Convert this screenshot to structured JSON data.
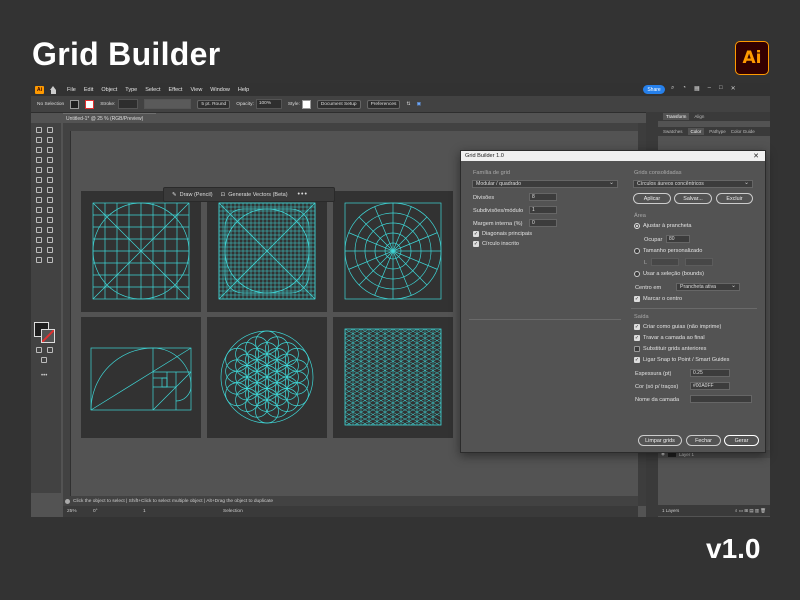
{
  "promo": {
    "title": "Grid Builder",
    "app_logo": "Ai",
    "version": "v1.0"
  },
  "menubar": {
    "app_badge": "Ai",
    "items": [
      "File",
      "Edit",
      "Object",
      "Type",
      "Select",
      "Effect",
      "View",
      "Window",
      "Help"
    ],
    "share": "Share"
  },
  "control_bar": {
    "selection": "No Selection",
    "stroke_label": "Stroke:",
    "brush": "5 pt. Round",
    "opacity_label": "Opacity:",
    "opacity_value": "100%",
    "style_label": "Style:",
    "document_setup": "Document Setup",
    "preferences": "Preferences"
  },
  "document_tab": {
    "title": "Untitled-1* @ 25 % (RGB/Preview)"
  },
  "floating_bar": {
    "draw": "Draw (Pencil)",
    "generate": "Generate Vectors (Beta)",
    "more": "•••"
  },
  "status": {
    "hint": "Click the object to select  |  Shift+Click to select multiple object  |  Alt+Drag the object to duplicate",
    "zoom": "25%",
    "angle": "0°",
    "page": "1",
    "mode": "Selection"
  },
  "panels": {
    "tabs_top": [
      "Transform",
      "Align"
    ],
    "tabs_second": [
      "Swatches",
      "Color",
      "Pathype",
      "Color Guide"
    ],
    "layer_name": "Layer 1",
    "layers_count": "1 Layers"
  },
  "dialog": {
    "title": "Grid Builder 1.0",
    "left": {
      "family_label": "Família de grid",
      "family_value": "Modular / quadrado",
      "fields": [
        {
          "label": "Divisões",
          "value": "8"
        },
        {
          "label": "Subdivisões/módulo",
          "value": "1"
        },
        {
          "label": "Margem interna (%)",
          "value": "0"
        }
      ],
      "checks": [
        {
          "label": "Diagonais principais",
          "checked": true
        },
        {
          "label": "Círculo inscrito",
          "checked": true
        }
      ]
    },
    "right": {
      "consolidated_label": "Grids consolidadas",
      "consolidated_value": "Círculos áureos concêntricos",
      "apply": "Aplicar",
      "save": "Salvar...",
      "delete": "Excluir",
      "area_label": "Área",
      "fit_artboard": "Ajustar à prancheta",
      "occupy_label": "Ocupar",
      "occupy_value": "80",
      "custom_size": "Tamanho personalizado",
      "custom_l": "L",
      "use_selection": "Usar a seleção (bounds)",
      "center_label": "Centro em",
      "center_value": "Prancheta ativa",
      "mark_center": "Marcar o centro",
      "output_label": "Saída",
      "output_checks": [
        {
          "label": "Criar como guias (não imprime)",
          "checked": true
        },
        {
          "label": "Travar a camada ao final",
          "checked": true
        },
        {
          "label": "Substituir grids anteriores",
          "checked": false
        },
        {
          "label": "Ligar Snap to Point / Smart Guides",
          "checked": true
        }
      ],
      "thickness_label": "Espessura (pt)",
      "thickness_value": "0.25",
      "color_label": "Cor (só p/ traços)",
      "color_value": "#00A0FF",
      "layer_label": "Nome da camada",
      "layer_value": ""
    },
    "buttons": {
      "clear": "Limpar grids",
      "close": "Fechar",
      "generate": "Gerar"
    }
  },
  "colors": {
    "grid_line": "#3fd6d6",
    "artboard": "#323232",
    "accent": "#2680eb"
  }
}
